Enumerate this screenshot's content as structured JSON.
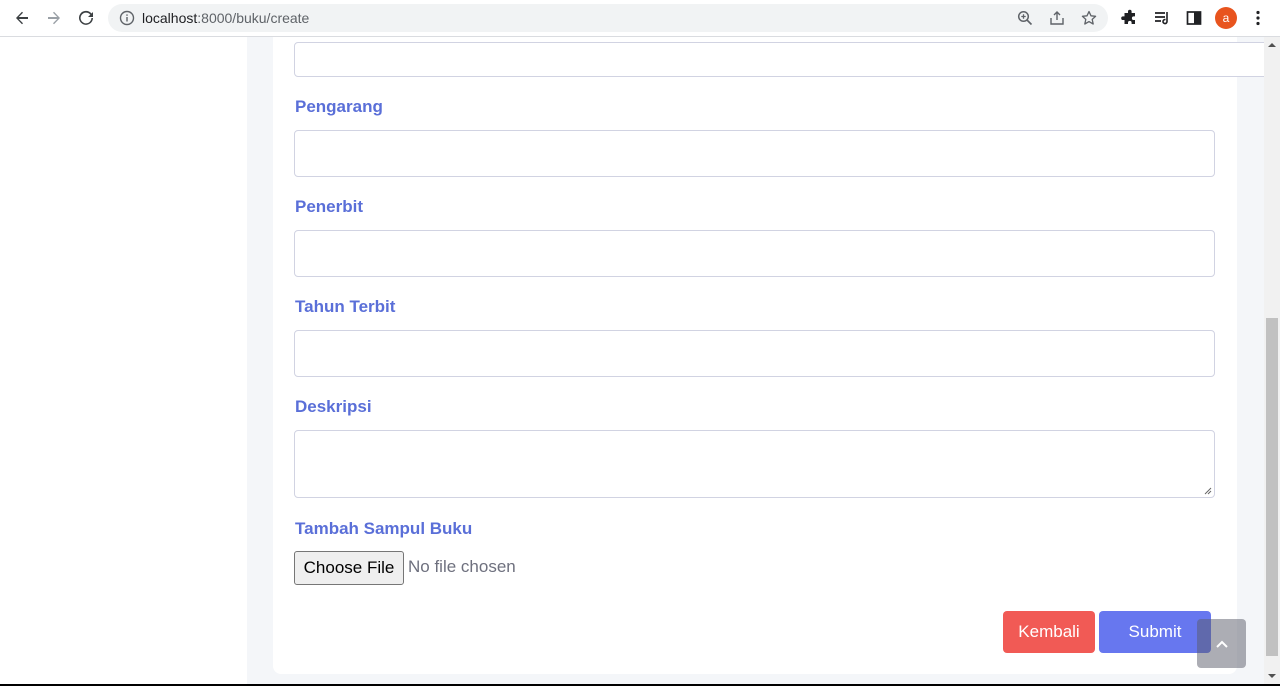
{
  "browser": {
    "url_host": "localhost",
    "url_path": ":8000/buku/create",
    "profile_initial": "a"
  },
  "form": {
    "fields": [
      {
        "label": "Pengarang"
      },
      {
        "label": "Penerbit"
      },
      {
        "label": "Tahun Terbit"
      },
      {
        "label": "Deskripsi"
      }
    ],
    "cover_label": "Tambah Sampul Buku",
    "file_button": "Choose File",
    "file_status": "No file chosen",
    "back_button": "Kembali",
    "submit_button": "Submit"
  },
  "colors": {
    "label": "#5a6fd8",
    "back": "#f15a55",
    "submit": "#6777ef"
  }
}
